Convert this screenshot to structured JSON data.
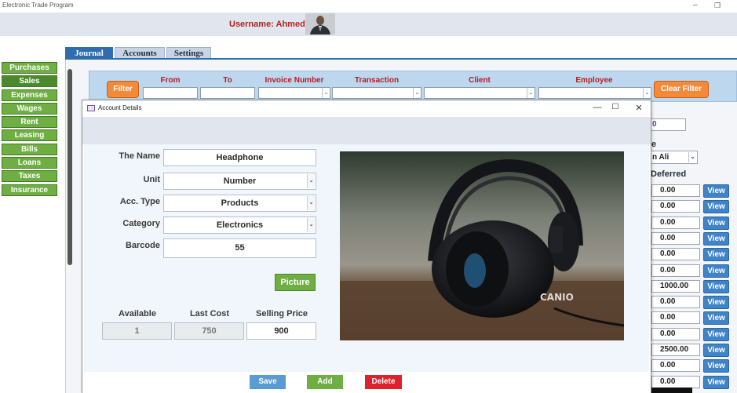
{
  "window": {
    "title": "Electronic Trade Program",
    "minimize": "–",
    "restore": "❐"
  },
  "header": {
    "username_label": "Username: Ahmed"
  },
  "tabs": [
    {
      "label": "Journal",
      "active": true
    },
    {
      "label": "Accounts",
      "active": false
    },
    {
      "label": "Settings",
      "active": false
    }
  ],
  "sidebar": {
    "items": [
      {
        "label": "Purchases",
        "active": false
      },
      {
        "label": "Sales",
        "active": true
      },
      {
        "label": "Expenses",
        "active": false
      },
      {
        "label": "Wages",
        "active": false
      },
      {
        "label": "Rent",
        "active": false
      },
      {
        "label": "Leasing",
        "active": false
      },
      {
        "label": "Bills",
        "active": false
      },
      {
        "label": "Loans",
        "active": false
      },
      {
        "label": "Taxes",
        "active": false
      },
      {
        "label": "Insurance",
        "active": false
      }
    ]
  },
  "filter": {
    "filter_button": "Filter",
    "clear_button": "Clear Filter",
    "labels": {
      "from": "From",
      "to": "To",
      "invoice_number": "Invoice Number",
      "transaction": "Transaction",
      "client": "Client",
      "employee": "Employee"
    }
  },
  "background": {
    "top_value": "0",
    "employee_label_fragment": "e",
    "employee_value": "n Ali",
    "deferred_header": "Deferred",
    "deferred_values": [
      "0.00",
      "0.00",
      "0.00",
      "0.00",
      "0.00",
      "0.00",
      "1000.00",
      "0.00",
      "0.00",
      "0.00",
      "2500.00",
      "0.00",
      "0.00"
    ],
    "view_label": "View"
  },
  "dialog": {
    "title": "Account Details",
    "controls": {
      "minimize": "—",
      "maximize": "☐",
      "close": "✕"
    },
    "fields": {
      "name": {
        "label": "The Name",
        "value": "Headphone"
      },
      "unit": {
        "label": "Unit",
        "value": "Number"
      },
      "acc_type": {
        "label": "Acc. Type",
        "value": "Products"
      },
      "category": {
        "label": "Category",
        "value": "Electronics"
      },
      "barcode": {
        "label": "Barcode",
        "value": "55"
      }
    },
    "picture_button": "Picture",
    "stats": {
      "available": {
        "label": "Available",
        "value": "1"
      },
      "last_cost": {
        "label": "Last Cost",
        "value": "750"
      },
      "selling_price": {
        "label": "Selling Price",
        "value": "900"
      }
    },
    "photo_logo_text": "CANIO"
  },
  "footer": {
    "save": "Save",
    "add": "Add",
    "delete": "Delete"
  },
  "colors": {
    "accent_blue": "#2f6cb0",
    "nav_green": "#6fae43",
    "filter_orange": "#f28a3a",
    "username_red": "#b32020",
    "view_blue": "#3f83c8",
    "delete_red": "#e0202a"
  }
}
